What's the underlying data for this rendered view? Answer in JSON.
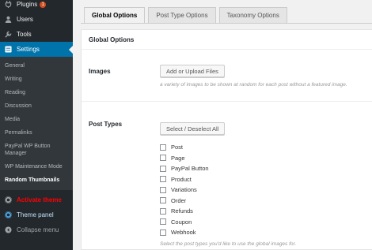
{
  "sidebar": {
    "top_items": [
      {
        "label": "Plugins",
        "icon": "plug-icon",
        "badge": "1"
      },
      {
        "label": "Users",
        "icon": "users-icon"
      },
      {
        "label": "Tools",
        "icon": "wrench-icon"
      },
      {
        "label": "Settings",
        "icon": "settings-icon"
      }
    ],
    "sub_items": [
      "General",
      "Writing",
      "Reading",
      "Discussion",
      "Media",
      "Permalinks",
      "PayPal WP Button Manager",
      "WP Maintenance Mode",
      "Random Thumbnails"
    ],
    "activate_theme": "Activate theme",
    "theme_panel": "Theme panel",
    "collapse_menu": "Collapse menu"
  },
  "tabs": [
    "Global Options",
    "Post Type Options",
    "Taxonomy Options"
  ],
  "panel": {
    "title": "Global Options",
    "images_label": "Images",
    "upload_button": "Add or Upload Files",
    "images_desc": "a variety of images to be shown at random for each post without a featured image.",
    "post_types_label": "Post Types",
    "select_button": "Select / Deselect All",
    "post_types": [
      "Post",
      "Page",
      "PayPal Button",
      "Product",
      "Variations",
      "Order",
      "Refunds",
      "Coupon",
      "Webhook"
    ],
    "post_types_desc": "Select the post types you'd like to use the global images for."
  },
  "colors": {
    "sidebar_bg": "#23282d",
    "accent": "#0073aa",
    "badge": "#d54e21",
    "activate": "#ff0000"
  }
}
